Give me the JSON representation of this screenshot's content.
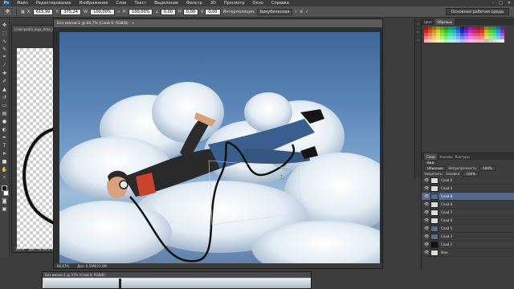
{
  "menu": {
    "logo": "Ps",
    "items": [
      "Файл",
      "Редактирование",
      "Изображение",
      "Слои",
      "Текст",
      "Выделение",
      "Фильтр",
      "3D",
      "Просмотр",
      "Окно",
      "Справка"
    ],
    "window_controls": [
      "–",
      "□",
      "✕"
    ]
  },
  "options": {
    "x_label": "X:",
    "x_value": "615,99",
    "y_label": "Y:",
    "y_value": "375,24",
    "w_label": "W:",
    "w_value": "100,00%",
    "h_label": "H:",
    "h_value": "100,00%",
    "angle_value": "0,00",
    "h2_value": "0,00",
    "v_value": "0,00",
    "interp_label": "Интерполяция:",
    "interp_value": "Бикубическая",
    "workspace": "Основная рабочая среда"
  },
  "doc_back": {
    "tab": "Linkinpedia_logo_Ame_Ampoule_grand_4 (С...",
    "status": "Док: 18,5M/0 байт",
    "zoom": "100%"
  },
  "doc_main": {
    "tab": "Без имени-1 @ 66,7% (Слой 9, RGB/8)",
    "close": "×",
    "zoom": "66,67%",
    "status": "Док: 6,59M/21,9M"
  },
  "doc_bottom": {
    "tab": "Без имени-1 @ 31% (Слой 9, RGB/8)"
  },
  "panels": {
    "color_tabs": [
      "Цвет",
      "Образцы"
    ],
    "layers_tabs": [
      "Слои",
      "Каналы",
      "Контуры"
    ],
    "kind_label": "Вид",
    "blend_mode": "Обычные",
    "opacity_label": "Непрозрачность:",
    "opacity_value": "100%",
    "lock_label": "Закрепить:",
    "fill_label": "Заливка:",
    "fill_value": "100%",
    "layers": [
      {
        "name": "Слой 9",
        "thumb": "light",
        "selected": false
      },
      {
        "name": "Слой 4",
        "thumb": "light",
        "selected": false
      },
      {
        "name": "Слой 8",
        "thumb": "dark",
        "selected": true
      },
      {
        "name": "Слой 8",
        "thumb": "light",
        "selected": false
      },
      {
        "name": "Слой 7",
        "thumb": "light",
        "selected": false
      },
      {
        "name": "Слой 6",
        "thumb": "light",
        "selected": false
      },
      {
        "name": "Слой 5",
        "thumb": "dark",
        "selected": false
      },
      {
        "name": "Слой 3",
        "thumb": "dark",
        "selected": false
      },
      {
        "name": "Слой 2",
        "thumb": "black",
        "selected": false
      },
      {
        "name": "Фон",
        "thumb": "light",
        "selected": false
      }
    ]
  },
  "colors": {
    "accent_selected": "#56688a",
    "panel_bg": "#3d3d3d",
    "sky": "#5a84b6"
  }
}
